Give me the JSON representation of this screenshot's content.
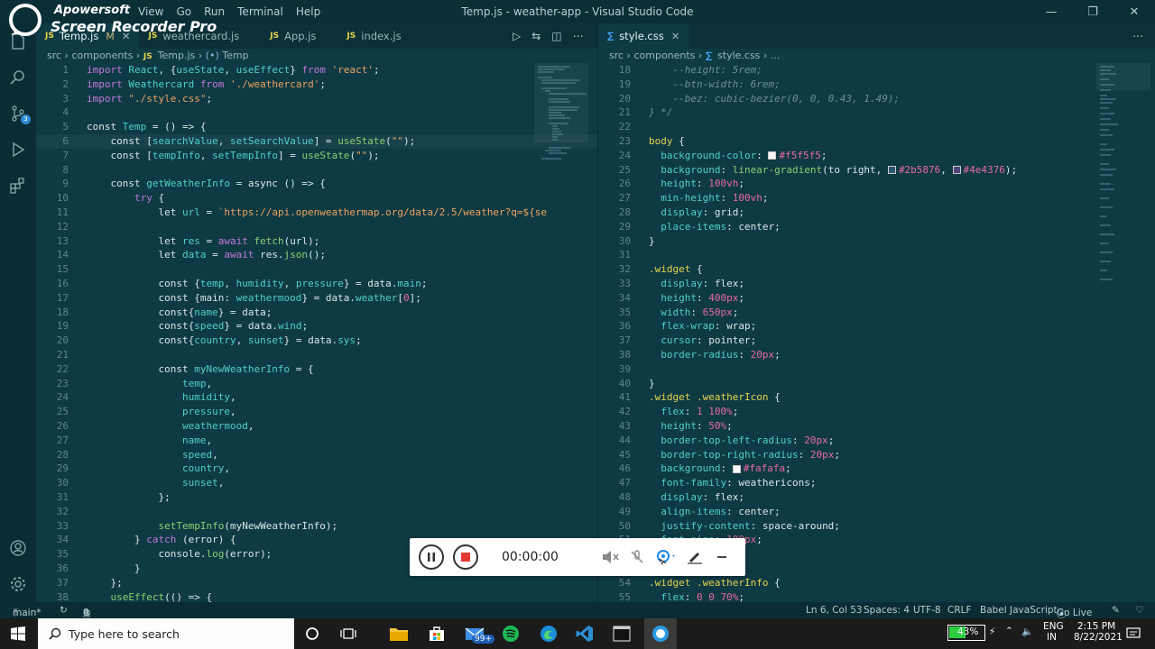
{
  "watermark": {
    "line1": "Apowersoft",
    "line2": "Screen Recorder Pro"
  },
  "menu": [
    "View",
    "Go",
    "Run",
    "Terminal",
    "Help"
  ],
  "window_title": "Temp.js - weather-app - Visual Studio Code",
  "left": {
    "tabs": [
      {
        "label": "Temp.js",
        "badge": "M",
        "type": "JS",
        "active": true
      },
      {
        "label": "weathercard.js",
        "type": "JS"
      },
      {
        "label": "App.js",
        "type": "JS"
      },
      {
        "label": "index.js",
        "type": "JS"
      }
    ],
    "breadcrumb": {
      "p1": "src",
      "p2": "components",
      "p3": "Temp.js",
      "p4": "Temp"
    },
    "lines": [
      {
        "n": "1",
        "h": "<span style='color:#c678dd'>import</span> <span style='color:#4fd1c5'>React</span>, {<span style='color:#4fd1c5'>useState</span>, <span style='color:#4fd1c5'>useEffect</span>} <span style='color:#c678dd'>from</span> <span style='color:#f0a35e'>'react'</span>;"
      },
      {
        "n": "2",
        "h": "<span style='color:#c678dd'>import</span> <span style='color:#4fd1c5'>Weathercard</span> <span style='color:#c678dd'>from</span> <span style='color:#f0a35e'>'./weathercard'</span>;"
      },
      {
        "n": "3",
        "h": "<span style='color:#c678dd'>import</span> <span style='color:#f0a35e'>\"./style.css\"</span>;"
      },
      {
        "n": "4",
        "h": ""
      },
      {
        "n": "5",
        "h": "const <span style='color:#4fd1c5'>Temp</span> = () =&gt; {"
      },
      {
        "n": "6",
        "h": "    const [<span style='color:#4fd1c5'>searchValue</span>, <span style='color:#4fd1c5'>setSearchValue</span>] = <span style='color:#8bd36e'>useState</span>(<span style='color:#f0a35e'>\"\"</span>);",
        "cur": true
      },
      {
        "n": "7",
        "h": "    const [<span style='color:#4fd1c5'>tempInfo</span>, <span style='color:#4fd1c5'>setTempInfo</span>] = <span style='color:#8bd36e'>useState</span>(<span style='color:#f0a35e'>\"\"</span>);"
      },
      {
        "n": "8",
        "h": ""
      },
      {
        "n": "9",
        "h": "    const <span style='color:#4fd1c5'>getWeatherInfo</span> = async () =&gt; {"
      },
      {
        "n": "10",
        "h": "        <span style='color:#c678dd'>try</span> {"
      },
      {
        "n": "11",
        "h": "            let <span style='color:#4fd1c5'>url</span> = <span style='color:#f0a35e'>`https://api.openweathermap.org/data/2.5/weather?q=${se</span>"
      },
      {
        "n": "12",
        "h": ""
      },
      {
        "n": "13",
        "h": "            let <span style='color:#4fd1c5'>res</span> = <span style='color:#c678dd'>await</span> <span style='color:#8bd36e'>fetch</span>(url);"
      },
      {
        "n": "14",
        "h": "            let <span style='color:#4fd1c5'>data</span> = <span style='color:#c678dd'>await</span> res.<span style='color:#8bd36e'>json</span>();"
      },
      {
        "n": "15",
        "h": ""
      },
      {
        "n": "16",
        "h": "            const {<span style='color:#4fd1c5'>temp</span>, <span style='color:#4fd1c5'>humidity</span>, <span style='color:#4fd1c5'>pressure</span>} = data.<span style='color:#4fd1c5'>main</span>;"
      },
      {
        "n": "17",
        "h": "            const {main: <span style='color:#4fd1c5'>weathermood</span>} = data.<span style='color:#4fd1c5'>weather</span>[<span style='color:#e86aa2'>0</span>];"
      },
      {
        "n": "18",
        "h": "            const{<span style='color:#4fd1c5'>name</span>} = data;"
      },
      {
        "n": "19",
        "h": "            const{<span style='color:#4fd1c5'>speed</span>} = data.<span style='color:#4fd1c5'>wind</span>;"
      },
      {
        "n": "20",
        "h": "            const{<span style='color:#4fd1c5'>country</span>, <span style='color:#4fd1c5'>sunset</span>} = data.<span style='color:#4fd1c5'>sys</span>;"
      },
      {
        "n": "21",
        "h": ""
      },
      {
        "n": "22",
        "h": "            const <span style='color:#4fd1c5'>myNewWeatherInfo</span> = {"
      },
      {
        "n": "23",
        "h": "                <span style='color:#4fd1c5'>temp</span>,"
      },
      {
        "n": "24",
        "h": "                <span style='color:#4fd1c5'>humidity</span>,"
      },
      {
        "n": "25",
        "h": "                <span style='color:#4fd1c5'>pressure</span>,"
      },
      {
        "n": "26",
        "h": "                <span style='color:#4fd1c5'>weathermood</span>,"
      },
      {
        "n": "27",
        "h": "                <span style='color:#4fd1c5'>name</span>,"
      },
      {
        "n": "28",
        "h": "                <span style='color:#4fd1c5'>speed</span>,"
      },
      {
        "n": "29",
        "h": "                <span style='color:#4fd1c5'>country</span>,"
      },
      {
        "n": "30",
        "h": "                <span style='color:#4fd1c5'>sunset</span>,"
      },
      {
        "n": "31",
        "h": "            };"
      },
      {
        "n": "32",
        "h": ""
      },
      {
        "n": "33",
        "h": "            <span style='color:#8bd36e'>setTempInfo</span>(myNewWeatherInfo);"
      },
      {
        "n": "34",
        "h": "        } <span style='color:#c678dd'>catch</span> (error) {"
      },
      {
        "n": "35",
        "h": "            console.<span style='color:#8bd36e'>log</span>(error);"
      },
      {
        "n": "36",
        "h": "        }"
      },
      {
        "n": "37",
        "h": "    };"
      },
      {
        "n": "38",
        "h": "    <span style='color:#8bd36e'>useEffect</span>(() =&gt; {"
      }
    ]
  },
  "right": {
    "tab": "style.css",
    "breadcrumb": {
      "p1": "src",
      "p2": "components",
      "p3": "style.css",
      "p4": "..."
    },
    "lines": [
      {
        "n": "18",
        "h": "<span class='comment'>    --height: 5rem;</span>"
      },
      {
        "n": "19",
        "h": "<span class='comment'>    --btn-width: 6rem;</span>"
      },
      {
        "n": "20",
        "h": "<span class='comment'>    --bez: cubic-bezier(0, 0, 0.43, 1.49);</span>"
      },
      {
        "n": "21",
        "h": "<span class='comment'>} */</span>"
      },
      {
        "n": "22",
        "h": ""
      },
      {
        "n": "23",
        "h": "<span style='color:#e8d44d'>body</span> {"
      },
      {
        "n": "24",
        "h": "  <span style='color:#4fd1c5'>background-color</span>: <span class='sw' style='background:#f5f5f5'></span><span style='color:#e86aa2'>#f5f5f5</span>;"
      },
      {
        "n": "25",
        "h": "  <span style='color:#4fd1c5'>background</span>: <span style='color:#8bd36e'>linear-gradient</span>(to right, <span class='sw' style='background:#2b5876'></span><span style='color:#e86aa2'>#2b5876</span>, <span class='sw' style='background:#4e4376'></span><span style='color:#e86aa2'>#4e4376</span>);"
      },
      {
        "n": "26",
        "h": "  <span style='color:#4fd1c5'>height</span>: <span style='color:#e86aa2'>100vh</span>;"
      },
      {
        "n": "27",
        "h": "  <span style='color:#4fd1c5'>min-height</span>: <span style='color:#e86aa2'>100vh</span>;"
      },
      {
        "n": "28",
        "h": "  <span style='color:#4fd1c5'>display</span>: grid;"
      },
      {
        "n": "29",
        "h": "  <span style='color:#4fd1c5'>place-items</span>: center;"
      },
      {
        "n": "30",
        "h": "}"
      },
      {
        "n": "31",
        "h": ""
      },
      {
        "n": "32",
        "h": "<span style='color:#e8d44d'>.widget</span> {"
      },
      {
        "n": "33",
        "h": "  <span style='color:#4fd1c5'>display</span>: flex;"
      },
      {
        "n": "34",
        "h": "  <span style='color:#4fd1c5'>height</span>: <span style='color:#e86aa2'>400px</span>;"
      },
      {
        "n": "35",
        "h": "  <span style='color:#4fd1c5'>width</span>: <span style='color:#e86aa2'>650px</span>;"
      },
      {
        "n": "36",
        "h": "  <span style='color:#4fd1c5'>flex-wrap</span>: wrap;"
      },
      {
        "n": "37",
        "h": "  <span style='color:#4fd1c5'>cursor</span>: pointer;"
      },
      {
        "n": "38",
        "h": "  <span style='color:#4fd1c5'>border-radius</span>: <span style='color:#e86aa2'>20px</span>;"
      },
      {
        "n": "39",
        "h": ""
      },
      {
        "n": "40",
        "h": "}"
      },
      {
        "n": "41",
        "h": "<span style='color:#e8d44d'>.widget .weatherIcon</span> {"
      },
      {
        "n": "42",
        "h": "  <span style='color:#4fd1c5'>flex</span>: <span style='color:#e86aa2'>1 100%</span>;"
      },
      {
        "n": "43",
        "h": "  <span style='color:#4fd1c5'>height</span>: <span style='color:#e86aa2'>50%</span>;"
      },
      {
        "n": "44",
        "h": "  <span style='color:#4fd1c5'>border-top-left-radius</span>: <span style='color:#e86aa2'>20px</span>;"
      },
      {
        "n": "45",
        "h": "  <span style='color:#4fd1c5'>border-top-right-radius</span>: <span style='color:#e86aa2'>20px</span>;"
      },
      {
        "n": "46",
        "h": "  <span style='color:#4fd1c5'>background</span>: <span class='sw' style='background:#fafafa'></span><span style='color:#e86aa2'>#fafafa</span>;"
      },
      {
        "n": "47",
        "h": "  <span style='color:#4fd1c5'>font-family</span>: weathericons;"
      },
      {
        "n": "48",
        "h": "  <span style='color:#4fd1c5'>display</span>: flex;"
      },
      {
        "n": "49",
        "h": "  <span style='color:#4fd1c5'>align-items</span>: center;"
      },
      {
        "n": "50",
        "h": "  <span style='color:#4fd1c5'>justify-content</span>: space-around;"
      },
      {
        "n": "51",
        "h": "  <span style='color:#4fd1c5'>font-size</span>: <span style='color:#e86aa2'>100px</span>;"
      },
      {
        "n": "52",
        "h": "}"
      },
      {
        "n": "53",
        "h": ""
      },
      {
        "n": "54",
        "h": "<span style='color:#e8d44d'>.widget .weatherInfo</span> {"
      },
      {
        "n": "55",
        "h": "  <span style='color:#4fd1c5'>flex</span>: <span style='color:#e86aa2'>0 0 70%</span>;"
      }
    ]
  },
  "recorder": {
    "time": "00:00:00"
  },
  "status": {
    "branch": "main*",
    "errors": "0",
    "warnings": "0",
    "position": "Ln 6, Col 53",
    "spaces": "Spaces: 4",
    "encoding": "UTF-8",
    "eol": "CRLF",
    "language": "Babel JavaScript",
    "golive": "Go Live"
  },
  "taskbar": {
    "search_placeholder": "Type here to search",
    "mail_badge": "99+",
    "battery": "43%",
    "lang1": "ENG",
    "lang2": "IN",
    "time": "2:15 PM",
    "date": "8/22/2021"
  }
}
